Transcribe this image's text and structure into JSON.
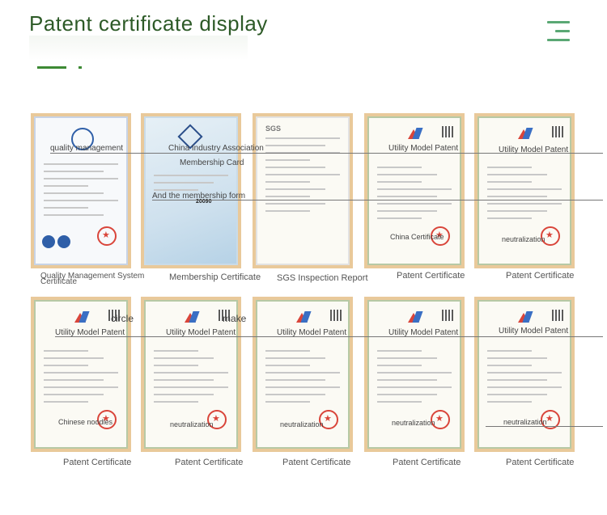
{
  "header": {
    "title": "Patent certificate display"
  },
  "certificates": [
    {
      "caption_line1": "Quality Management System",
      "caption_line2": "Certificate",
      "overlay": "quality management"
    },
    {
      "caption_line1": "Membership Certificate",
      "overlay1": "China Industry Association",
      "overlay2": "Membership Card",
      "overlay3": "And the membership form",
      "number": "20090"
    },
    {
      "caption_line1": "SGS Inspection Report",
      "brand": "SGS"
    },
    {
      "caption_line1": "Patent Certificate",
      "overlay1": "Utility Model Patent",
      "overlay2": "China Certificate"
    },
    {
      "caption_line1": "Patent Certificate",
      "overlay1": "Utility Model Patent",
      "overlay2": "neutralization"
    },
    {
      "caption_line1": "Patent Certificate",
      "overlay1": "Utility Model Patent",
      "overlay2": "Chinese noodles",
      "overlay3": "circle"
    },
    {
      "caption_line1": "Patent Certificate",
      "overlay1": "Utility Model Patent",
      "overlay2": "neutralization",
      "overlay3": "make"
    },
    {
      "caption_line1": "Patent Certificate",
      "overlay1": "Utility Model Patent",
      "overlay2": "neutralization"
    },
    {
      "caption_line1": "Patent Certificate",
      "overlay1": "Utility Model Patent",
      "overlay2": "neutralization"
    },
    {
      "caption_line1": "Patent Certificate",
      "overlay1": "Utility Model Patent",
      "overlay2": "neutralization"
    }
  ],
  "colors": {
    "title": "#2d5a27",
    "accent": "#3d8a34",
    "frame": "#e9c99a",
    "menu_icon": "#5aa874"
  },
  "icons": {
    "menu": "hamburger-menu-icon"
  }
}
